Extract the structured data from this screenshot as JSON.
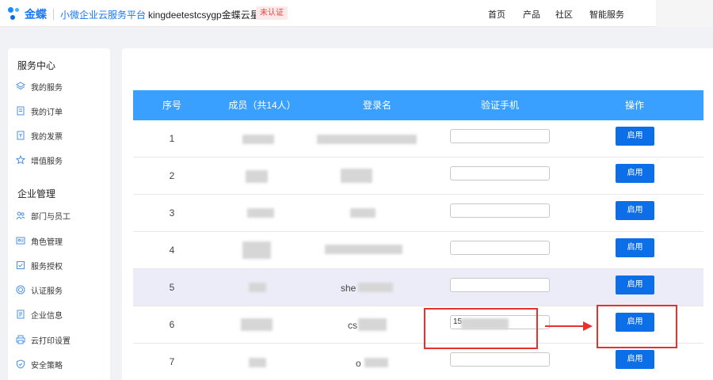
{
  "header": {
    "logo_name": "金蝶",
    "logo_subtitle": "小微企业云服务平台",
    "company_name": "kingdeetestcsygp金蝶云星辰",
    "cert_status": "未认证",
    "nav": [
      "首页",
      "产品",
      "社区",
      "智能服务"
    ]
  },
  "sidebar": {
    "section1_title": "服务中心",
    "section1_items": [
      {
        "label": "我的服务",
        "icon": "layers-icon"
      },
      {
        "label": "我的订单",
        "icon": "order-icon"
      },
      {
        "label": "我的发票",
        "icon": "invoice-icon"
      },
      {
        "label": "增值服务",
        "icon": "star-icon"
      }
    ],
    "section2_title": "企业管理",
    "section2_items": [
      {
        "label": "部门与员工",
        "icon": "people-icon"
      },
      {
        "label": "角色管理",
        "icon": "role-icon"
      },
      {
        "label": "服务授权",
        "icon": "checkbox-icon"
      },
      {
        "label": "认证服务",
        "icon": "target-icon"
      },
      {
        "label": "企业信息",
        "icon": "document-icon"
      },
      {
        "label": "云打印设置",
        "icon": "printer-icon"
      },
      {
        "label": "安全策略",
        "icon": "shield-icon"
      }
    ]
  },
  "table": {
    "columns": [
      "序号",
      "成员（共14人）",
      "登录名",
      "验证手机",
      "操作"
    ],
    "rows": [
      {
        "no": "1",
        "login_prefix": "",
        "phone": "",
        "action": "启用"
      },
      {
        "no": "2",
        "login_prefix": "",
        "phone": "",
        "action": "启用"
      },
      {
        "no": "3",
        "login_prefix": "",
        "phone": "",
        "action": "启用"
      },
      {
        "no": "4",
        "login_prefix": "",
        "phone": "",
        "action": "启用"
      },
      {
        "no": "5",
        "login_prefix": "she",
        "phone": "",
        "action": "启用"
      },
      {
        "no": "6",
        "login_prefix": "cs",
        "phone": "15",
        "action": "启用"
      },
      {
        "no": "7",
        "login_prefix": "o",
        "phone": "",
        "action": "启用"
      }
    ]
  },
  "colors": {
    "accent": "#1677ff",
    "table_header": "#3aa0ff",
    "button": "#0d6fe8",
    "highlight_row": "#ececf9",
    "annotation": "#e8312c"
  }
}
